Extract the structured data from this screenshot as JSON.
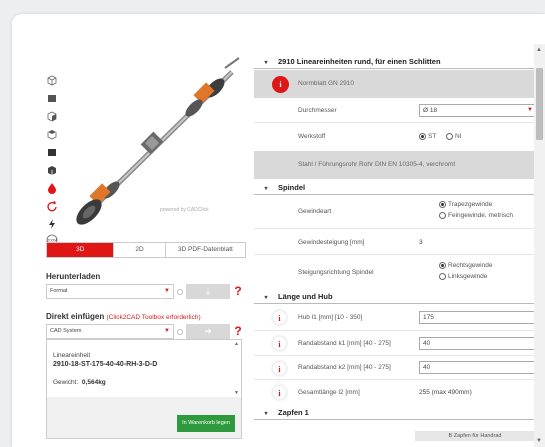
{
  "viewer": {
    "powered_by": "powered by CADClick",
    "tools": [
      "cube-iso-icon",
      "cube-front-icon",
      "cube-side-icon",
      "cube-top-icon",
      "cube-solid-icon",
      "cube-edges-icon",
      "color-drop-icon",
      "rotate-icon",
      "explode-icon",
      "zoom-icon"
    ],
    "zoom_label": "ZOOM"
  },
  "tabs": [
    {
      "label": "3D",
      "active": true
    },
    {
      "label": "2D",
      "active": false
    },
    {
      "label": "3D PDF-Datenblatt",
      "active": false
    }
  ],
  "download": {
    "title": "Herunterladen",
    "select_value": "Format",
    "download_glyph": "⤓",
    "help": "?"
  },
  "insert": {
    "title": "Direkt einfügen",
    "note": "(Click2CAD Toolbox erforderlich)",
    "select_value": "CAD System",
    "arrow_glyph": "➜",
    "help": "?"
  },
  "article": {
    "type_label": "Lineareinheit",
    "code": "2910-18-ST-175-40-40-RH-3-D-D",
    "weight_label": "Gewicht:",
    "weight_value": "0,564kg",
    "cart_button": "In Warenkorb legen"
  },
  "config": {
    "main_header": "2910 Lineareinheiten rund, für einen Schlitten",
    "norm_text": "Normblatt GN 2910",
    "diameter_label": "Durchmesser",
    "diameter_value": "Ø 18",
    "material_label": "Werkstoff",
    "material_options": [
      "ST",
      "NI"
    ],
    "material_selected": "ST",
    "material_desc": "Stahl / Führungsrohr Rohr DIN EN 10305-4, verchromt",
    "spindle_header": "Spindel",
    "thread_label": "Gewindeart",
    "thread_options": [
      "Trapezgewinde",
      "Feingewinde, metrisch"
    ],
    "thread_selected": "Trapezgewinde",
    "pitch_label": "Gewindesteigung [mm]",
    "pitch_value": "3",
    "direction_label": "Steigungsrichtung Spindel",
    "direction_options": [
      "Rechtsgewinde",
      "Linksgewinde"
    ],
    "direction_selected": "Rechtsgewinde",
    "length_header": "Länge und Hub",
    "stroke_label": "Hub l1 [mm] [10 - 350]",
    "stroke_value": "175",
    "k1_label": "Randabstand k1 [mm] [40 - 275]",
    "k1_value": "40",
    "k2_label": "Randabstand k2 [mm] [40 - 275]",
    "k2_value": "40",
    "total_label": "Gesamtlänge l2 [mm]",
    "total_value": "255 (max 490mm)",
    "pin_header": "Zapfen 1",
    "pin_button": "B Zapfen für Handrad",
    "info_glyph": "i"
  },
  "colors": {
    "accent": "#e01616",
    "cart": "#2f9a3d",
    "grey_row": "#d9d9d9"
  }
}
